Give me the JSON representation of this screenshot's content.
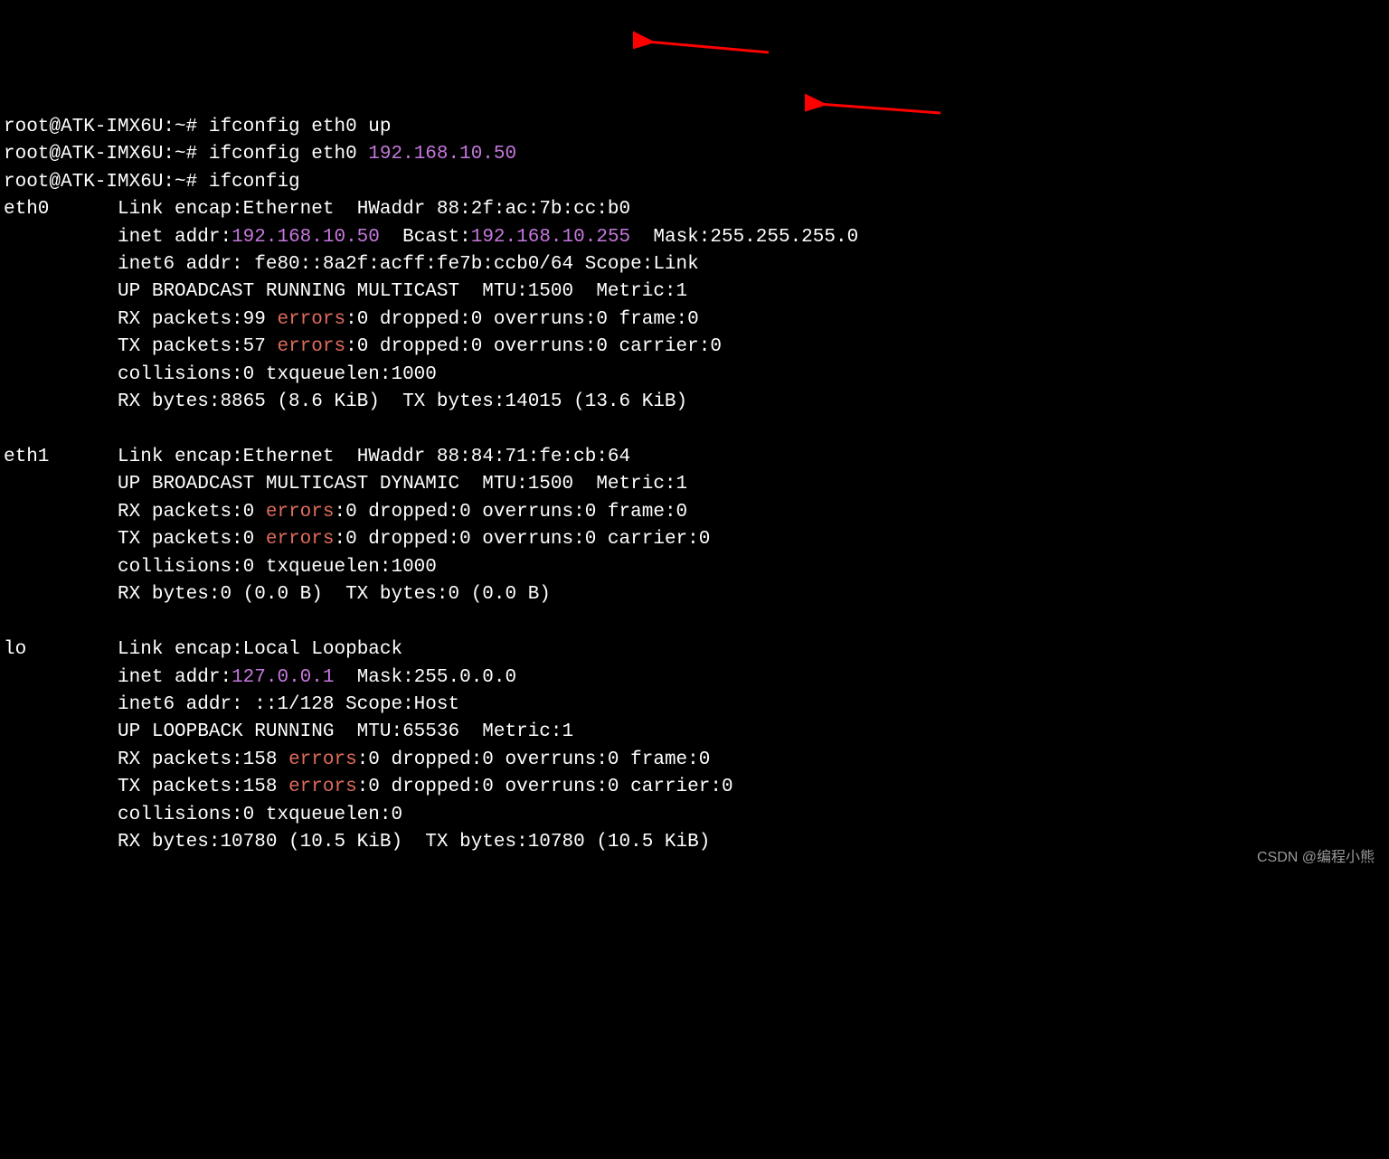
{
  "prompt": "root@ATK-IMX6U:~# ",
  "cmd1": "ifconfig eth0 up",
  "cmd2_a": "ifconfig eth0 ",
  "cmd2_ip": "192.168.10.50",
  "cmd3": "ifconfig",
  "eth0": {
    "name": "eth0",
    "link": "Link encap:Ethernet  HWaddr 88:2f:ac:7b:cc:b0",
    "inet_pre": "inet addr:",
    "inet_addr": "192.168.10.50",
    "bcast_pre": "  Bcast:",
    "bcast": "192.168.10.255",
    "mask_pre": "  Mask:255.255.255.0",
    "inet6": "inet6 addr: fe80::8a2f:acff:fe7b:ccb0/64 Scope:Link",
    "flags": "UP BROADCAST RUNNING MULTICAST  MTU:1500  Metric:1",
    "rx_a": "RX packets:99 ",
    "rx_err": "errors",
    "rx_b": ":0 dropped:0 overruns:0 frame:0",
    "tx_a": "TX packets:57 ",
    "tx_err": "errors",
    "tx_b": ":0 dropped:0 overruns:0 carrier:0",
    "coll": "collisions:0 txqueuelen:1000",
    "bytes": "RX bytes:8865 (8.6 KiB)  TX bytes:14015 (13.6 KiB)"
  },
  "eth1": {
    "name": "eth1",
    "link": "Link encap:Ethernet  HWaddr 88:84:71:fe:cb:64",
    "flags": "UP BROADCAST MULTICAST DYNAMIC  MTU:1500  Metric:1",
    "rx_a": "RX packets:0 ",
    "rx_err": "errors",
    "rx_b": ":0 dropped:0 overruns:0 frame:0",
    "tx_a": "TX packets:0 ",
    "tx_err": "errors",
    "tx_b": ":0 dropped:0 overruns:0 carrier:0",
    "coll": "collisions:0 txqueuelen:1000",
    "bytes": "RX bytes:0 (0.0 B)  TX bytes:0 (0.0 B)"
  },
  "lo": {
    "name": "lo",
    "link": "Link encap:Local Loopback",
    "inet_pre": "inet addr:",
    "inet_addr": "127.0.0.1",
    "mask_pre": "  Mask:255.0.0.0",
    "inet6": "inet6 addr: ::1/128 Scope:Host",
    "flags": "UP LOOPBACK RUNNING  MTU:65536  Metric:1",
    "rx_a": "RX packets:158 ",
    "rx_err": "errors",
    "rx_b": ":0 dropped:0 overruns:0 frame:0",
    "tx_a": "TX packets:158 ",
    "tx_err": "errors",
    "tx_b": ":0 dropped:0 overruns:0 carrier:0",
    "coll": "collisions:0 txqueuelen:0",
    "bytes": "RX bytes:10780 (10.5 KiB)  TX bytes:10780 (10.5 KiB)"
  },
  "indent": "          ",
  "watermark": "CSDN @编程小熊"
}
